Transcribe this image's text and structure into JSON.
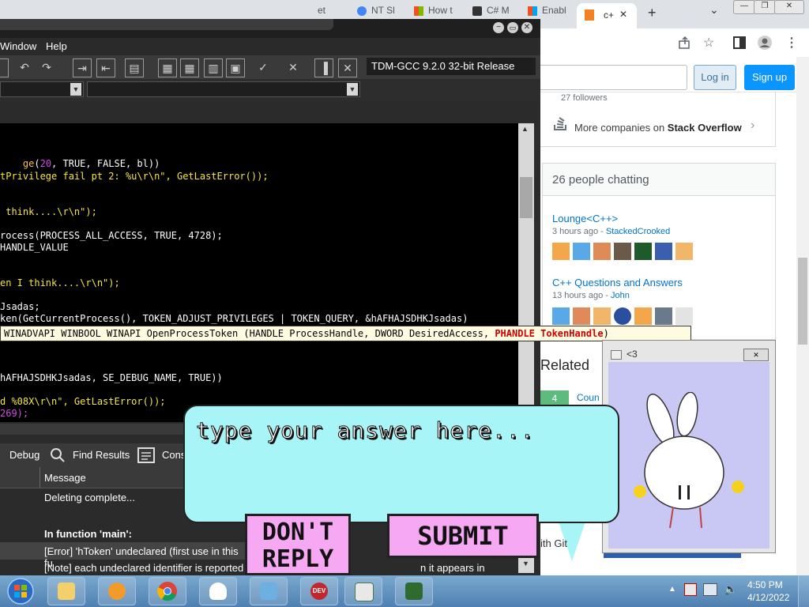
{
  "browser": {
    "tabs": [
      {
        "label": "et"
      },
      {
        "label": "NT Sl"
      },
      {
        "label": "How t"
      },
      {
        "label": "C# M"
      },
      {
        "label": "Enabl"
      },
      {
        "label": "c+"
      }
    ],
    "active_tab_close": "✕",
    "new_tab": "+",
    "chevron": "⌄",
    "window_controls": [
      "—",
      "❐",
      "✕"
    ]
  },
  "so": {
    "followers": "27 followers",
    "login": "Log in",
    "signup": "Sign up",
    "more_companies_prefix": "More companies on ",
    "more_companies_brand": "Stack Overflow",
    "chat_header": "26 people chatting",
    "rooms": [
      {
        "name": "Lounge<C++>",
        "meta_time": "3 hours ago",
        "meta_user": "StackedCrooked"
      },
      {
        "name": "C++ Questions and Answers",
        "meta_time": "13 hours ago",
        "meta_user": "John"
      }
    ],
    "related": "Related",
    "related_score": "4",
    "related_link": "Coun",
    "partial_text": "ith Git"
  },
  "devcpp": {
    "menu": [
      "Window",
      "Help"
    ],
    "compiler": "TDM-GCC 9.2.0 32-bit Release",
    "code_lines": [
      {
        "text": "ge(20, TRUE, FALSE, bl))"
      },
      {
        "text": "tPrivilege fail pt 2: %u\\r\\n\", GetLastError());"
      },
      {
        "text": " think....\\r\\n\");"
      },
      {
        "text": "rocess(PROCESS_ALL_ACCESS, TRUE, 4728);"
      },
      {
        "text": "HANDLE_VALUE"
      },
      {
        "text": "en I think....\\r\\n\");"
      },
      {
        "text": "Jsadas;"
      },
      {
        "text": "ken(GetCurrentProcess(), TOKEN_ADJUST_PRIVILEGES | TOKEN_QUERY, &hAFHAJSDHKJsadas)"
      },
      {
        "text": "hAFHAJSDHKJsadas, SE_DEBUG_NAME, TRUE))"
      },
      {
        "text": "d %08X\\r\\n\", GetLastError());"
      },
      {
        "text": "269);"
      }
    ],
    "tooltip_main": "WINADVAPI WINBOOL WINAPI OpenProcessToken (HANDLE ProcessHandle, DWORD DesiredAccess, ",
    "tooltip_param": "PHANDLE TokenHandle",
    "tooltip_end": ")",
    "bottom_tabs": [
      "Debug",
      "Find Results",
      "Cons"
    ],
    "message_header": "Message",
    "messages": [
      "Deleting complete...",
      "",
      "In function 'main':",
      "[Error] 'hToken' undeclared (first use in this fu",
      "[Note] each undeclared identifier is reported o"
    ],
    "partial_message_tail": "n it appears in"
  },
  "widget": {
    "title": "<3",
    "close": "✕"
  },
  "bubble": {
    "placeholder": "type your answer here...",
    "dont_reply": "DON'T REPLY",
    "submit": "SUBMIT"
  },
  "taskbar": {
    "time": "4:50 PM",
    "date": "4/12/2022"
  },
  "colors": {
    "accent": "#0a95ff",
    "so_orange": "#f48024",
    "bubble": "#a8f5f7",
    "pink_button": "#f7a8f2",
    "widget_bg": "#c9c8f5"
  }
}
